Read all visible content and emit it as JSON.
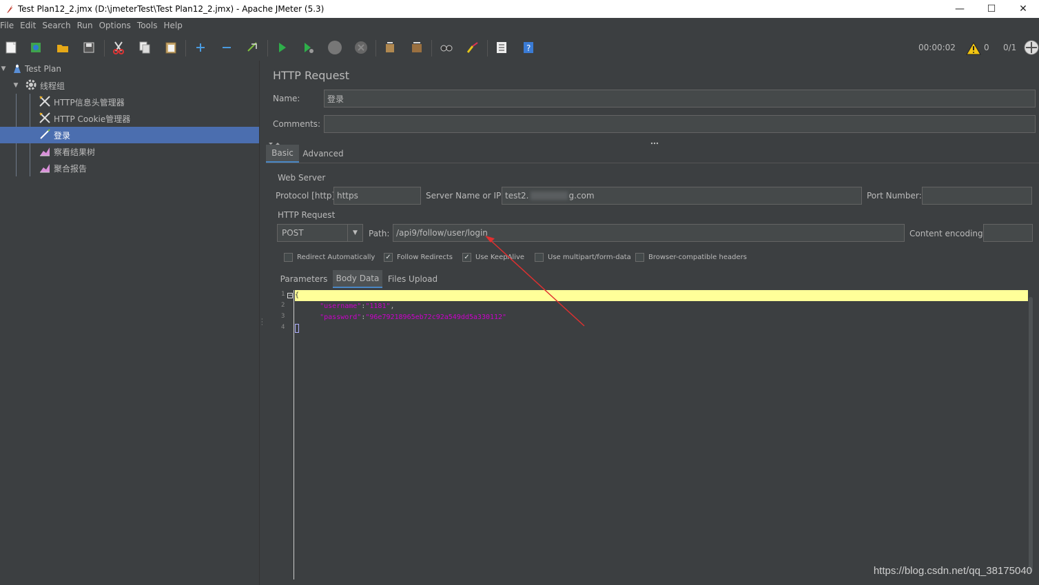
{
  "window": {
    "title": "Test Plan12_2.jmx (D:\\jmeterTest\\Test Plan12_2.jmx) - Apache JMeter (5.3)",
    "minimize": "—",
    "maximize": "☐",
    "close": "✕"
  },
  "menu": {
    "items": [
      {
        "label": "File"
      },
      {
        "label": "Edit"
      },
      {
        "label": "Search"
      },
      {
        "label": "Run"
      },
      {
        "label": "Options"
      },
      {
        "label": "Tools"
      },
      {
        "label": "Help"
      }
    ]
  },
  "toolbar": {
    "timer": "00:00:02",
    "warnings": "0",
    "threads": "0/1"
  },
  "tree": {
    "items": [
      {
        "label": "Test Plan",
        "icon": "test-plan-icon"
      },
      {
        "label": "线程组",
        "icon": "gear-icon"
      },
      {
        "label": "HTTP信息头管理器",
        "icon": "tools-icon"
      },
      {
        "label": "HTTP Cookie管理器",
        "icon": "tools-icon"
      },
      {
        "label": "登录",
        "icon": "sampler-pen-icon"
      },
      {
        "label": "察看结果树",
        "icon": "chart-listener-icon"
      },
      {
        "label": "聚合报告",
        "icon": "chart-listener-icon"
      }
    ]
  },
  "panel": {
    "title": "HTTP Request",
    "name_label": "Name:",
    "name_value": "登录",
    "comments_label": "Comments:",
    "comments_value": "",
    "tabs": [
      {
        "label": "Basic"
      },
      {
        "label": "Advanced"
      }
    ],
    "web_server": {
      "title": "Web Server",
      "protocol_label": "Protocol [http]:",
      "protocol_value": "https",
      "server_label": "Server Name or IP:",
      "server_value_prefix": "test2.",
      "server_value_suffix": "g.com",
      "port_label": "Port Number:",
      "port_value": ""
    },
    "http_request": {
      "title": "HTTP Request",
      "method": "POST",
      "path_label": "Path:",
      "path_value": "/api9/follow/user/login",
      "encoding_label": "Content encoding:",
      "encoding_value": ""
    },
    "options": [
      {
        "label": "Redirect Automatically",
        "checked": false
      },
      {
        "label": "Follow Redirects",
        "checked": true
      },
      {
        "label": "Use KeepAlive",
        "checked": true
      },
      {
        "label": "Use multipart/form-data",
        "checked": false
      },
      {
        "label": "Browser-compatible headers",
        "checked": false
      }
    ],
    "subtabs": [
      {
        "label": "Parameters"
      },
      {
        "label": "Body Data"
      },
      {
        "label": "Files Upload"
      }
    ],
    "body": {
      "line_numbers": [
        "1",
        "2",
        "3",
        "4"
      ],
      "line1": "{",
      "username_key": "\"username\"",
      "username_val": "\"1181\"",
      "password_key": "\"password\"",
      "password_val": "\"96e79218965eb72c92a549dd5a330112\""
    }
  },
  "watermark": "https://blog.csdn.net/qq_38175040"
}
